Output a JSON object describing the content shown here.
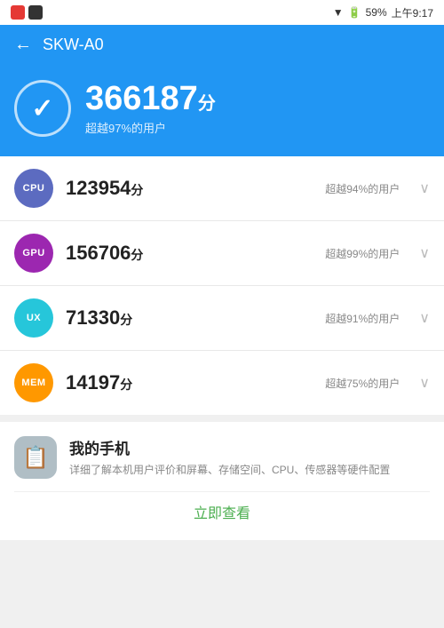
{
  "statusBar": {
    "time": "上午9:17",
    "battery": "59%",
    "appIcons": [
      "red-app",
      "dark-app"
    ]
  },
  "header": {
    "backLabel": "←",
    "title": "SKW-A0"
  },
  "scoreBanner": {
    "totalScore": "366187",
    "unit": "分",
    "subText": "超越97%的用户"
  },
  "scoreRows": [
    {
      "badge": "CPU",
      "badgeClass": "badge-cpu",
      "score": "123954",
      "unit": "分",
      "subText": "超越94%的用户"
    },
    {
      "badge": "GPU",
      "badgeClass": "badge-gpu",
      "score": "156706",
      "unit": "分",
      "subText": "超越99%的用户"
    },
    {
      "badge": "UX",
      "badgeClass": "badge-ux",
      "score": "71330",
      "unit": "分",
      "subText": "超越91%的用户"
    },
    {
      "badge": "MEM",
      "badgeClass": "badge-mem",
      "score": "14197",
      "unit": "分",
      "subText": "超越75%的用户"
    }
  ],
  "myPhone": {
    "title": "我的手机",
    "description": "详细了解本机用户评价和屏幕、存储空间、CPU、传感器等硬件配置",
    "checkNowLabel": "立即查看"
  }
}
